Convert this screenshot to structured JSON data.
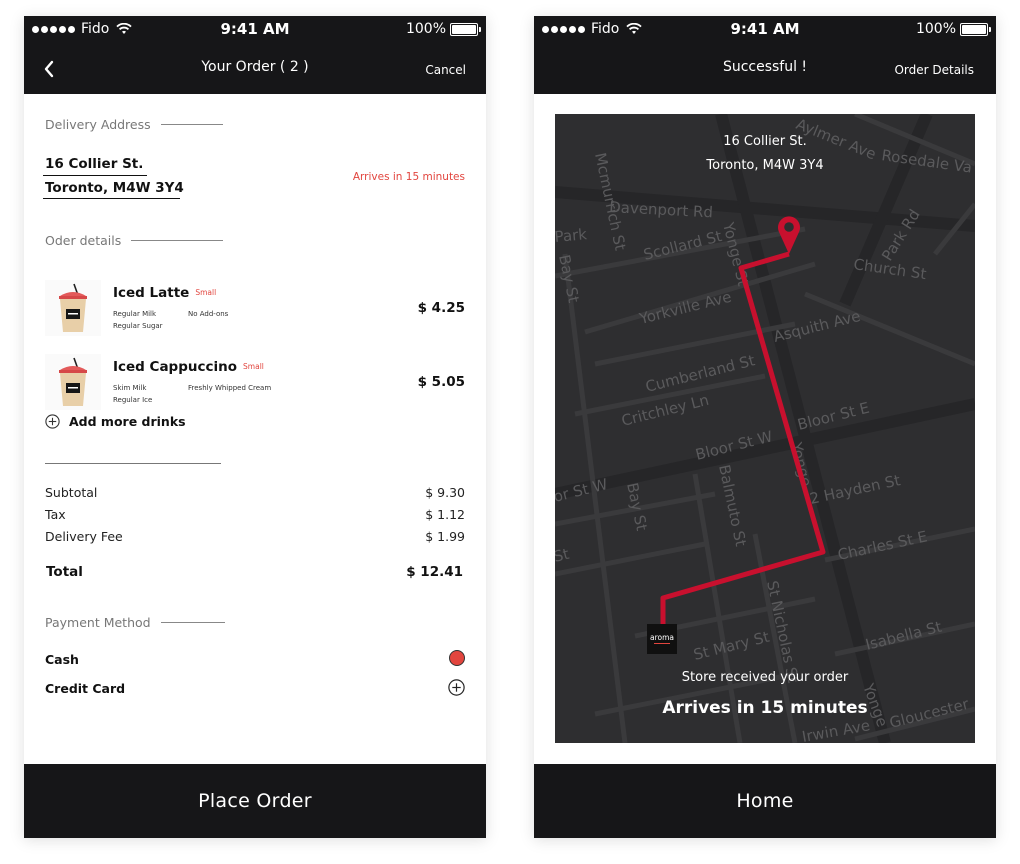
{
  "status_bar": {
    "carrier": "Fido",
    "time": "9:41 AM",
    "battery": "100%"
  },
  "order_screen": {
    "title": "Your Order ( 2 )",
    "cancel_label": "Cancel",
    "delivery_address_label": "Delivery Address",
    "address_line1": "16 Collier St.",
    "address_line2": "Toronto,  M4W 3Y4",
    "eta_text": "Arrives in 15 minutes",
    "order_details_label": "Oder details",
    "items": [
      {
        "name": "Iced Latte",
        "size": "Small",
        "option1": "Regular Milk",
        "option2": "Regular Sugar",
        "option3": "No Add-ons",
        "price": "$ 4.25"
      },
      {
        "name": "Iced Cappuccino",
        "size": "Small",
        "option1": "Skim Milk",
        "option2": "Regular Ice",
        "option3": "Freshly Whipped Cream",
        "price": "$ 5.05"
      }
    ],
    "add_more_label": "Add more drinks",
    "summary": {
      "subtotal_label": "Subtotal",
      "subtotal_value": "$ 9.30",
      "tax_label": "Tax",
      "tax_value": "$ 1.12",
      "delivery_fee_label": "Delivery Fee",
      "delivery_fee_value": "$ 1.99",
      "total_label": "Total",
      "total_value": "$ 12.41"
    },
    "payment_method_label": "Payment Method",
    "payment_options": [
      {
        "label": "Cash",
        "selected": true
      },
      {
        "label": "Credit Card",
        "selected": false
      }
    ],
    "place_order_label": "Place Order"
  },
  "success_screen": {
    "title": "Successful !",
    "order_details_label": "Order Details",
    "map_address_line1": "16 Collier St.",
    "map_address_line2": "Toronto, M4W 3Y4",
    "store_logo_text": "aroma",
    "status_text": "Store received your order",
    "eta_text": "Arrives in 15 minutes",
    "home_label": "Home",
    "streets": {
      "mcmurrich": "Mcmurrich St",
      "aylmer": "Aylmer Ave",
      "rosedale": "Rosedale Va",
      "davenport": "Davenport Rd",
      "scollard": "Scollard St",
      "yonge_top": "Yonge St",
      "park_rd": "Park Rd",
      "park": "Park",
      "church": "Church St",
      "bay_top": "Bay St",
      "yorkville": "Yorkville Ave",
      "asquith": "Asquith Ave",
      "cumberland": "Cumberland St",
      "critchley": "Critchley Ln",
      "bloor_e": "Bloor St E",
      "bloor_w": "Bloor St W",
      "yonge_mid": "Yonge",
      "hayden": "2 Hayden St",
      "or_st_w": "or St W",
      "balmuto": "Balmuto St",
      "bay_bottom": "Bay St",
      "charles": "Charles St E",
      "st_left": "St",
      "st_nicholas": "St Nicholas St",
      "st_mary": "St Mary St",
      "isabella": "Isabella St",
      "yonge_bottom": "Yonge",
      "irwin": "Irwin Ave",
      "gloucester": "Gloucester"
    }
  },
  "colors": {
    "bar": "#161618",
    "accent_red": "#e2453e",
    "route_red": "#c8102e",
    "map_bg": "#2e2e30"
  }
}
